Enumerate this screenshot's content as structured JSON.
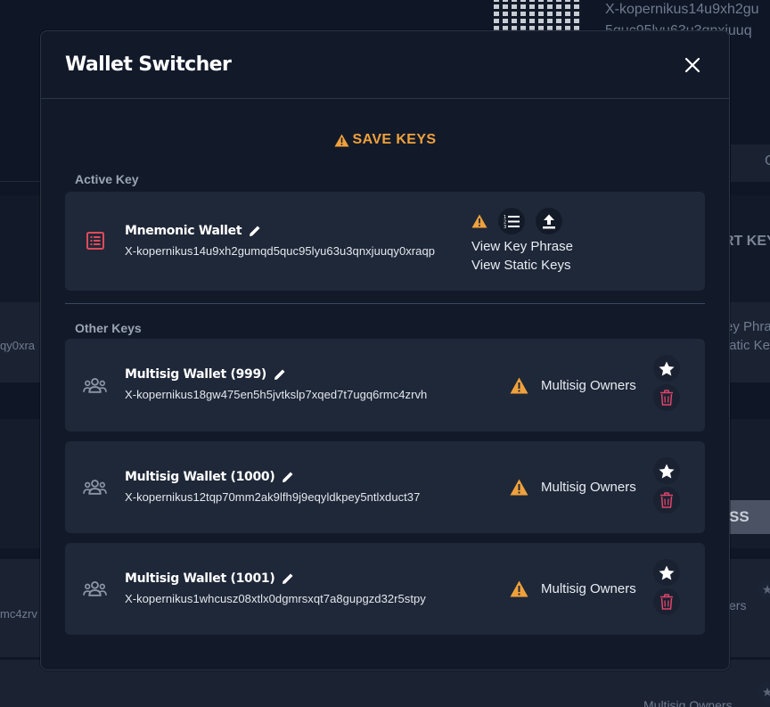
{
  "modal": {
    "title": "Wallet Switcher",
    "save_keys": "SAVE KEYS",
    "active_label": "Active Key",
    "other_label": "Other Keys"
  },
  "active_wallet": {
    "name": "Mnemonic Wallet",
    "address": "X-kopernikus14u9xh2gumqd5quc95lyu63u3qnxjuuqy0xraqp",
    "view_phrase": "View Key Phrase",
    "view_static": "View Static Keys",
    "icon": "mnemonic-list-icon"
  },
  "other_wallets": [
    {
      "name": "Multisig Wallet (999)",
      "address": "X-kopernikus18gw475en5h5jvtkslp7xqed7t7ugq6rmc4zrvh",
      "owners_label": "Multisig Owners"
    },
    {
      "name": "Multisig Wallet (1000)",
      "address": "X-kopernikus12tqp70mm2ak9lfh9j9eqyldkpey5ntlxduct37",
      "owners_label": "Multisig Owners"
    },
    {
      "name": "Multisig Wallet (1001)",
      "address": "X-kopernikus1whcusz08xtlx0dgmrsxqt7a8gupgzd32r5stpy",
      "owners_label": "Multisig Owners"
    }
  ],
  "background": {
    "addr_line1": "X-kopernikus14u9xh2gu",
    "addr_line2": "5quc95lyu63u3qnxjuuq",
    "export_fragment": "RT KEY",
    "phrase_fragment": "ey Phra",
    "static_fragment": "tatic Ke",
    "addr_fragment1": "qy0xra",
    "addr_fragment2": "mc4zrv",
    "dismiss_fragment": "ISS",
    "owners_fragment": "ers",
    "owners_full": "Multisig Owners",
    "c_fragment": "C"
  },
  "colors": {
    "warning": "#f0a13b",
    "danger": "#e0456a",
    "mnemonic_icon": "#e04a5a"
  }
}
